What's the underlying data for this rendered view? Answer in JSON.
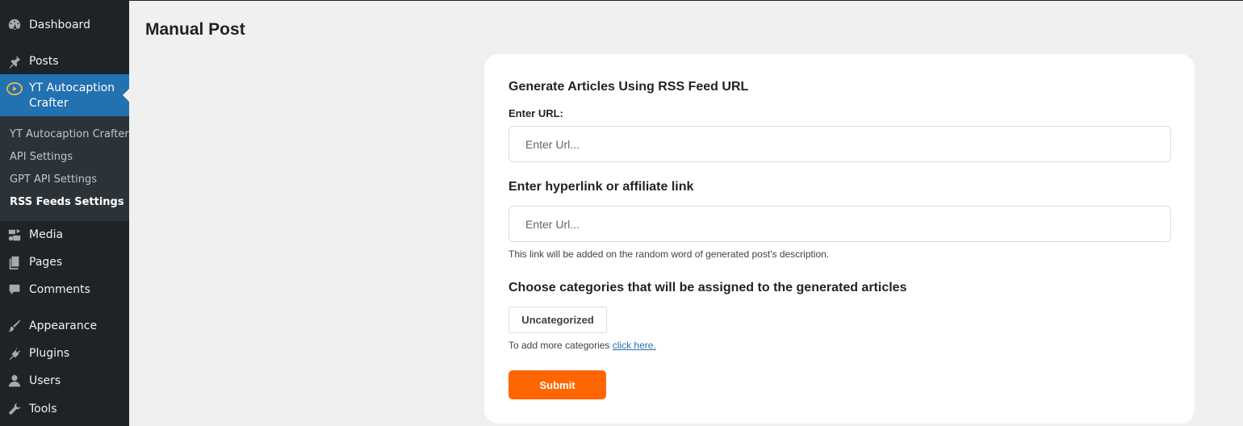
{
  "sidebar": {
    "items": [
      {
        "label": "Dashboard",
        "icon": "dashboard-icon"
      },
      {
        "label": "Posts",
        "icon": "pin-icon"
      },
      {
        "label": "YT Autocaption Crafter",
        "icon": "play-icon"
      },
      {
        "label": "Media",
        "icon": "media-icon"
      },
      {
        "label": "Pages",
        "icon": "pages-icon"
      },
      {
        "label": "Comments",
        "icon": "comment-icon"
      },
      {
        "label": "Appearance",
        "icon": "brush-icon"
      },
      {
        "label": "Plugins",
        "icon": "plug-icon"
      },
      {
        "label": "Users",
        "icon": "user-icon"
      },
      {
        "label": "Tools",
        "icon": "wrench-icon"
      }
    ],
    "current_label_line1": "YT Autocaption",
    "current_label_line2": "Crafter",
    "submenu": [
      {
        "label": "YT Autocaption Crafter"
      },
      {
        "label": "API Settings"
      },
      {
        "label": "GPT API Settings"
      },
      {
        "label": "RSS Feeds Settings"
      }
    ]
  },
  "main": {
    "title": "Manual Post",
    "form": {
      "rss_title": "Generate Articles Using RSS Feed URL",
      "url_label": "Enter URL:",
      "url_placeholder": "Enter Url...",
      "hyperlink_title": "Enter hyperlink or affiliate link",
      "hyperlink_placeholder": "Enter Url...",
      "hyperlink_help": "This link will be added on the random word of generated post's description.",
      "categories_title": "Choose categories that will be assigned to the generated articles",
      "category_button": "Uncategorized",
      "add_categories_text": "To add more categories ",
      "add_categories_link": "click here.",
      "submit_label": "Submit"
    }
  },
  "colors": {
    "sidebar_bg": "#1d2327",
    "submenu_bg": "#2c3338",
    "accent": "#2271b1",
    "submit": "#ff6600",
    "page_bg": "#f0f0f1"
  }
}
